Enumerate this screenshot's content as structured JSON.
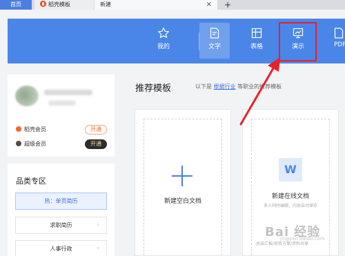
{
  "tabs": {
    "home": "首页",
    "daoke": "稻壳模板",
    "new_tab": "新建",
    "close": "×",
    "add": "+"
  },
  "toolbar": {
    "items": [
      {
        "label": "我的",
        "icon": "star-icon"
      },
      {
        "label": "文字",
        "icon": "document-icon",
        "active": true
      },
      {
        "label": "表格",
        "icon": "table-icon"
      },
      {
        "label": "演示",
        "icon": "presentation-icon",
        "highlighted": true
      },
      {
        "label": "PDF",
        "icon": "pdf-icon"
      }
    ],
    "accent_color": "#4a86e8",
    "highlight_color": "#e8202a"
  },
  "user": {
    "members": [
      {
        "label": "稻壳会员",
        "button": "开通"
      },
      {
        "label": "超级会员",
        "button": "开通"
      }
    ]
  },
  "categories": {
    "title": "品类专区",
    "items": [
      {
        "label": "热：单页简历",
        "active": true
      },
      {
        "label": "求职简历"
      },
      {
        "label": "人事行政"
      }
    ]
  },
  "main": {
    "title": "推荐模板",
    "subtitle_prefix": "以下是",
    "subtitle_link": "根据行业",
    "subtitle_suffix": "等职业的推荐模板",
    "cards": [
      {
        "label": "新建空白文档"
      },
      {
        "label": "新建在线文档",
        "desc": "多人同时编辑，内容自动保存",
        "footer": "总结汇报/项目方案/资料共享",
        "icon_letter": "W"
      }
    ]
  },
  "watermark": {
    "text": "Bai 经验",
    "sub": "jingyan.baidu.com"
  }
}
